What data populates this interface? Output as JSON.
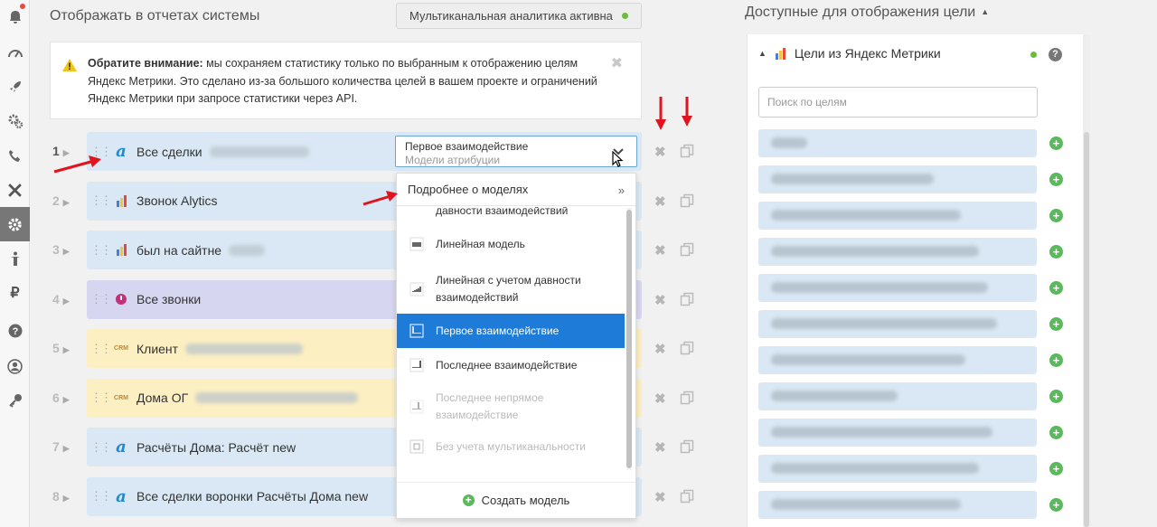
{
  "header": {
    "title": "Отображать в отчетах системы",
    "multichannel_badge": "Мультиканальная аналитика активна"
  },
  "notice": {
    "bold": "Обратите внимание:",
    "text": " мы сохраняем статистику только по выбранным к отображению целям Яндекс Метрики. Это сделано из-за большого количества целей в вашем проекте и ограничений Яндекс Метрики при запросе статистики через API."
  },
  "goals": [
    {
      "num": "1",
      "name": "Все сделки",
      "icon": "alytics-a-icon",
      "color": "blue",
      "blurred_suffix": true
    },
    {
      "num": "2",
      "name": "Звонок Alytics",
      "icon": "yandex-metrika-icon",
      "color": "blue",
      "blurred_suffix": false
    },
    {
      "num": "3",
      "name": "был на сайтне",
      "icon": "yandex-metrika-icon",
      "color": "blue",
      "blurred_suffix": true
    },
    {
      "num": "4",
      "name": "Все звонки",
      "icon": "calltracking-icon",
      "color": "purple",
      "blurred_suffix": false
    },
    {
      "num": "5",
      "name": "Клиент",
      "icon": "crm-icon",
      "color": "yellow",
      "blurred_suffix": true
    },
    {
      "num": "6",
      "name": "Дома ОГ",
      "icon": "crm-icon",
      "color": "yellow",
      "blurred_suffix": true
    },
    {
      "num": "7",
      "name": "Расчёты Дома: Расчёт new",
      "icon": "alytics-a-icon",
      "color": "blue",
      "blurred_suffix": false
    },
    {
      "num": "8",
      "name": "Все сделки воронки Расчёты Дома new",
      "icon": "alytics-a-icon",
      "color": "blue",
      "blurred_suffix": false
    }
  ],
  "attribution_select": {
    "value": "Первое взаимодействие",
    "label": "Модели атрибуции"
  },
  "dropdown": {
    "header": "Подробнее о моделях",
    "header_arrow": "»",
    "items": [
      {
        "label": "давности взаимодействий",
        "state": "partial"
      },
      {
        "label": "Линейная модель",
        "state": "normal"
      },
      {
        "label": "Линейная с учетом давности взаимодействий",
        "state": "normal"
      },
      {
        "label": "Первое взаимодействие",
        "state": "selected"
      },
      {
        "label": "Последнее взаимодействие",
        "state": "normal"
      },
      {
        "label": "Последнее непрямое взаимодействие",
        "state": "disabled"
      },
      {
        "label": "Без учета мультиканальности",
        "state": "disabled"
      }
    ],
    "create_label": "Создать модель"
  },
  "right_panel": {
    "title": "Доступные для отображения цели",
    "source_title": "Цели из Яндекс Метрики",
    "search_placeholder": "Поиск по целям",
    "available_rows": 11
  },
  "colors": {
    "accent": "#1e7bd8",
    "row_blue": "#d9e8f4",
    "row_purple": "#d6d6f0",
    "row_yellow": "#fcefc2",
    "status_green": "#6cbc3c",
    "arrow_red": "#e0141e"
  }
}
